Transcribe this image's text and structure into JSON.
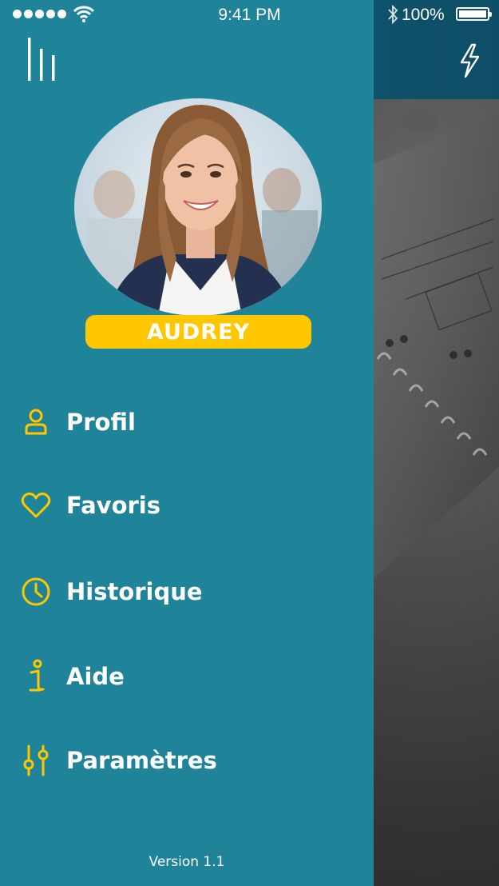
{
  "status_bar": {
    "time": "9:41 PM",
    "battery": "100%"
  },
  "profile": {
    "name": "AUDREY"
  },
  "menu": {
    "items": [
      {
        "label": "Profil",
        "icon": "user-icon"
      },
      {
        "label": "Favoris",
        "icon": "heart-icon"
      },
      {
        "label": "Historique",
        "icon": "clock-icon"
      },
      {
        "label": "Aide",
        "icon": "info-icon"
      },
      {
        "label": "Paramètres",
        "icon": "sliders-icon"
      }
    ]
  },
  "version": "Version 1.1",
  "colors": {
    "drawer": "#1f8499",
    "accent": "#ffc700",
    "header": "#14607a"
  }
}
